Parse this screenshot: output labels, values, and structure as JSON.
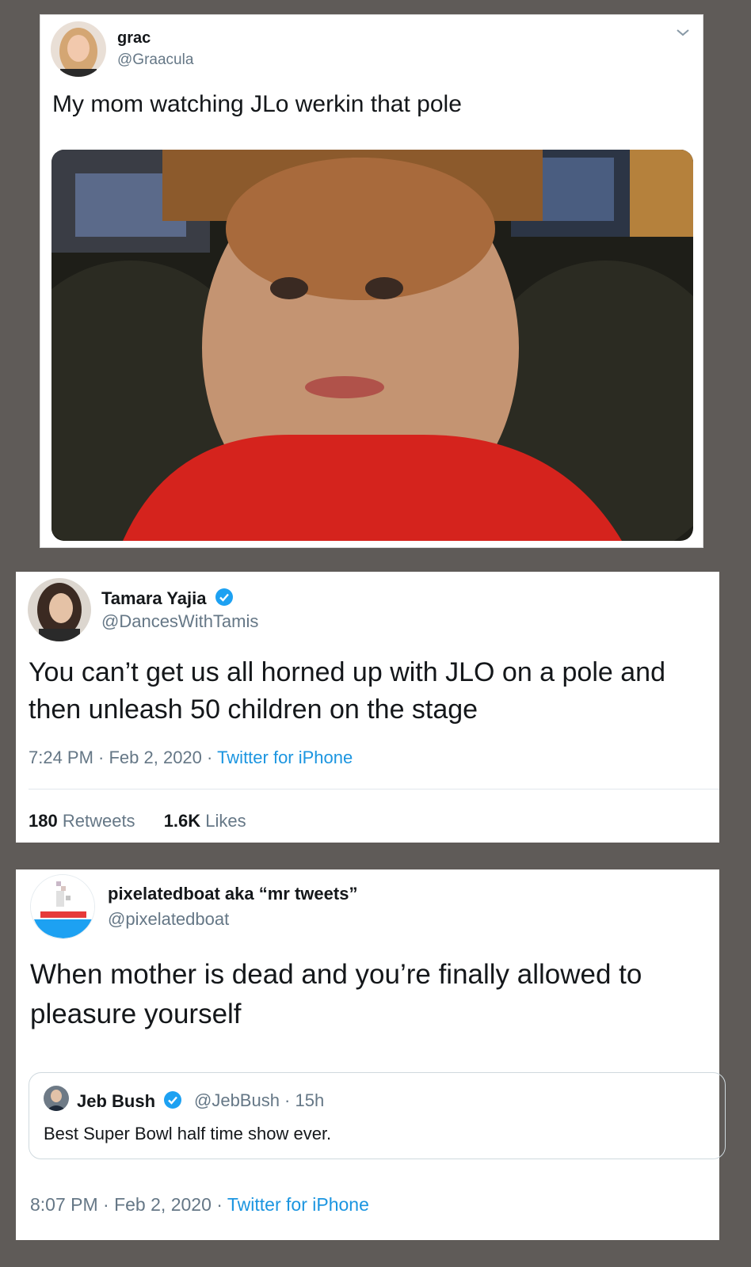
{
  "tweets": [
    {
      "name": "grac",
      "handle": "@Graacula",
      "text": "My mom watching JLo werkin that pole",
      "icons": {
        "menu": "chevron-down-icon",
        "avatar": "avatar",
        "media": "photo"
      }
    },
    {
      "name": "Tamara Yajia",
      "handle": "@DancesWithTamis",
      "verified": true,
      "text": "You can’t get us all horned up with JLO on a pole and then unleash 50 children on the stage",
      "time": "7:24 PM · Feb 2, 2020 · ",
      "source": "Twitter for iPhone",
      "retweets_count": "180",
      "retweets_label": "Retweets",
      "likes_count": "1.6K",
      "likes_label": "Likes"
    },
    {
      "name": "pixelatedboat aka “mr tweets”",
      "handle": "@pixelatedboat",
      "text": "When mother is dead and you’re finally allowed to pleasure yourself",
      "quote": {
        "name": "Jeb Bush",
        "verified": true,
        "handle": "@JebBush · 15h",
        "text": "Best Super Bowl half time show ever."
      },
      "time": "8:07 PM · Feb 2, 2020 · ",
      "source": "Twitter for iPhone"
    }
  ],
  "colors": {
    "background": "#5f5b58",
    "text": "#14171a",
    "secondary": "#657786",
    "link": "#1b95e0",
    "verified": "#1da1f2"
  }
}
